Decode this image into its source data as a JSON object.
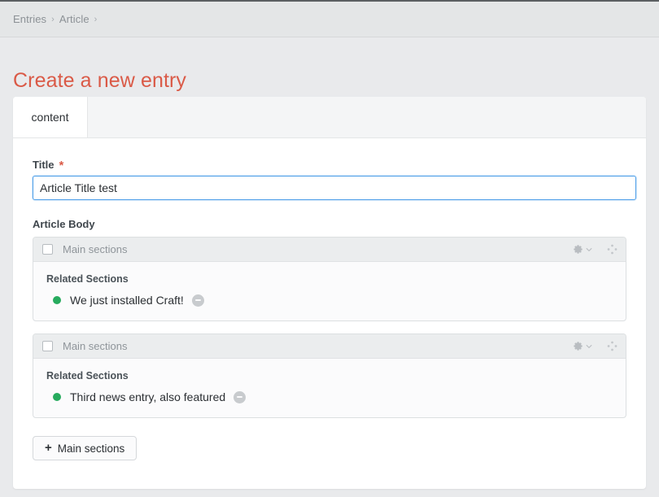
{
  "breadcrumb": {
    "items": [
      "Entries",
      "Article"
    ],
    "separator": "›"
  },
  "page": {
    "title": "Create a new entry",
    "title_color": "#da5a47"
  },
  "tabs": [
    {
      "label": "content",
      "active": true
    }
  ],
  "fields": {
    "title": {
      "label": "Title",
      "required_marker": "*",
      "value": "Article Title test",
      "placeholder": "",
      "focus_border_color": "#4d9ee8"
    },
    "article_body": {
      "label": "Article Body",
      "add_button": {
        "plus": "+",
        "label": "Main sections"
      },
      "blocks": [
        {
          "header_label": "Main sections",
          "checked": false,
          "settings_icon": "gear-icon",
          "settings_chevron": "chevron-down-icon",
          "move_icon": "move-handle-icon",
          "sub_label": "Related Sections",
          "entries": [
            {
              "status": "live",
              "status_color": "#27ab5e",
              "name": "We just installed Craft!",
              "remove_icon": "remove-circle-icon"
            }
          ]
        },
        {
          "header_label": "Main sections",
          "checked": false,
          "settings_icon": "gear-icon",
          "settings_chevron": "chevron-down-icon",
          "move_icon": "move-handle-icon",
          "sub_label": "Related Sections",
          "entries": [
            {
              "status": "live",
              "status_color": "#27ab5e",
              "name": "Third news entry, also featured",
              "remove_icon": "remove-circle-icon"
            }
          ]
        }
      ]
    }
  }
}
